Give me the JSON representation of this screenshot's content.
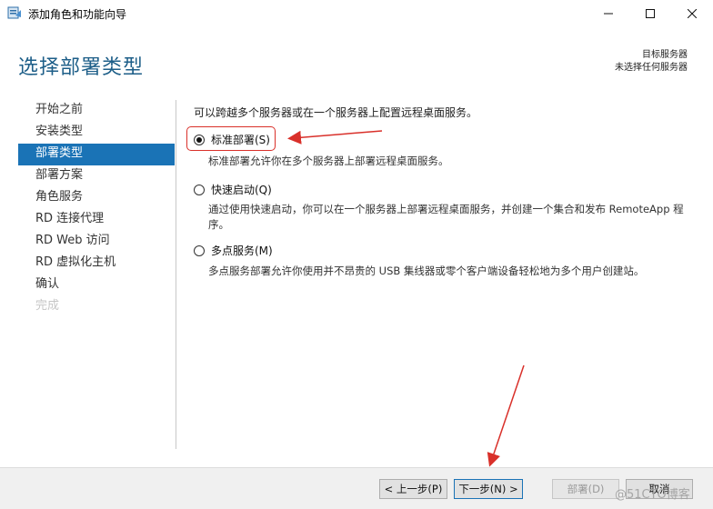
{
  "window": {
    "title": "添加角色和功能向导",
    "controls": {
      "minimize": "minimize-icon",
      "maximize": "maximize-icon",
      "close": "close-icon"
    }
  },
  "header": {
    "page_title": "选择部署类型",
    "destination_label": "目标服务器",
    "destination_value": "未选择任何服务器"
  },
  "nav": {
    "items": [
      {
        "label": "开始之前",
        "state": "normal"
      },
      {
        "label": "安装类型",
        "state": "normal"
      },
      {
        "label": "部署类型",
        "state": "active"
      },
      {
        "label": "部署方案",
        "state": "normal"
      },
      {
        "label": "角色服务",
        "state": "normal"
      },
      {
        "label": "RD 连接代理",
        "state": "normal"
      },
      {
        "label": "RD Web 访问",
        "state": "normal"
      },
      {
        "label": "RD 虚拟化主机",
        "state": "normal"
      },
      {
        "label": "确认",
        "state": "normal"
      },
      {
        "label": "完成",
        "state": "disabled"
      }
    ]
  },
  "content": {
    "intro": "可以跨越多个服务器或在一个服务器上配置远程桌面服务。",
    "options": [
      {
        "label": "标准部署(S)",
        "selected": true,
        "description": "标准部署允许你在多个服务器上部署远程桌面服务。"
      },
      {
        "label": "快速启动(Q)",
        "selected": false,
        "description": "通过使用快速启动，你可以在一个服务器上部署远程桌面服务，并创建一个集合和发布 RemoteApp 程序。"
      },
      {
        "label": "多点服务(M)",
        "selected": false,
        "description": "多点服务部署允许你使用并不昂贵的 USB 集线器或零个客户端设备轻松地为多个用户创建站。"
      }
    ]
  },
  "footer": {
    "prev_label": "< 上一步(P)",
    "next_label": "下一步(N) >",
    "deploy_label": "部署(D)",
    "cancel_label": "取消"
  },
  "watermark": "@51CTO博客",
  "colors": {
    "accent": "#1a73b6",
    "title": "#1d5e88",
    "annotation": "#d9302a"
  }
}
